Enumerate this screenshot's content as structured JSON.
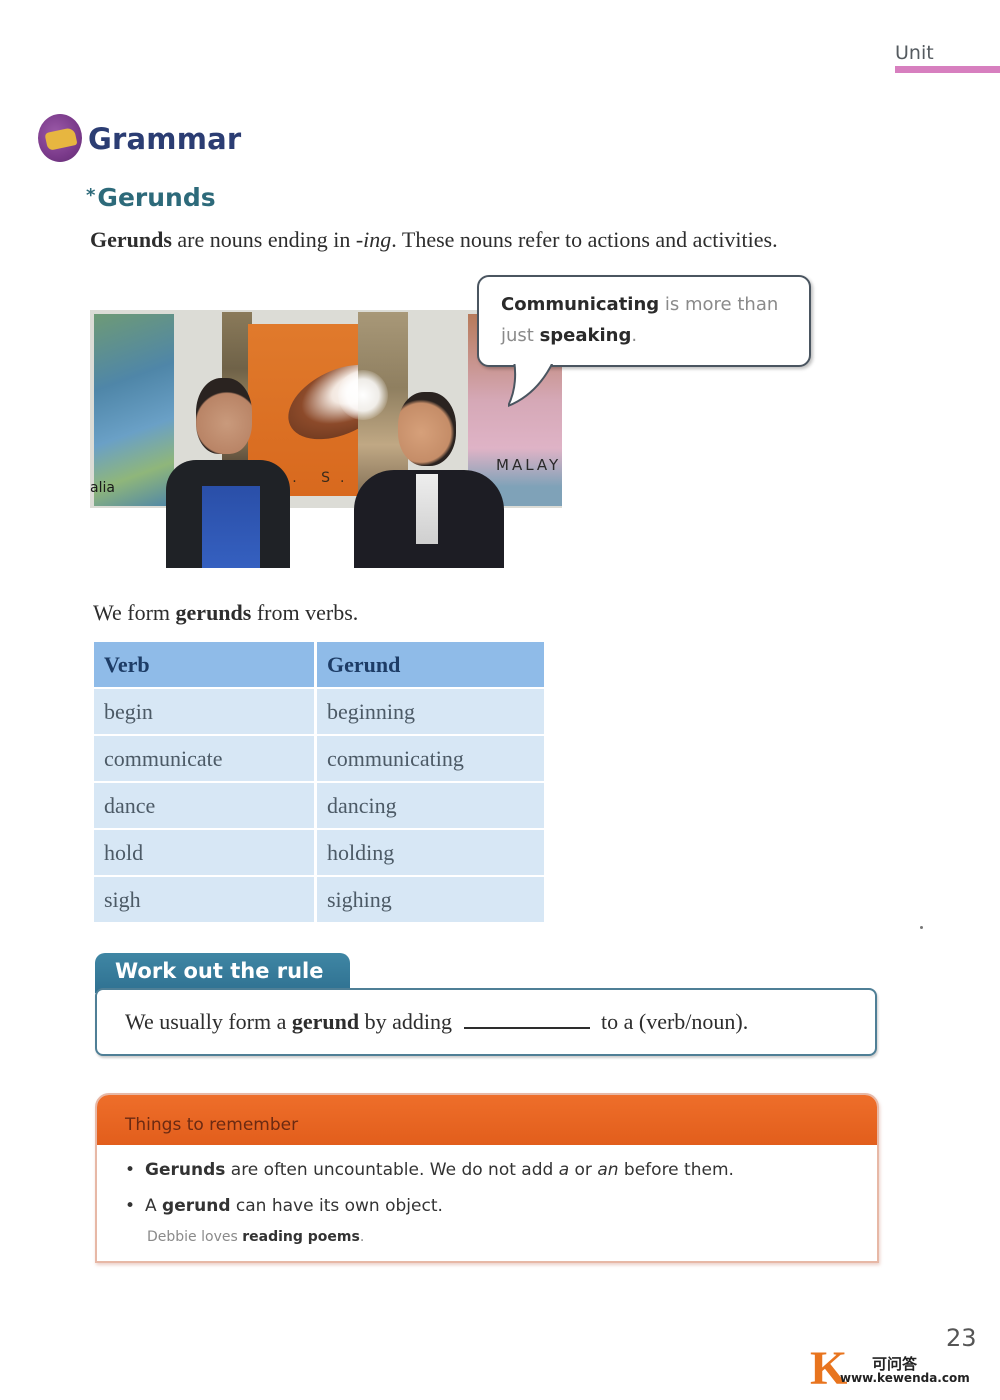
{
  "header": {
    "unit_label": "Unit",
    "unit_bar_color": "#d77fbf"
  },
  "section": {
    "title": "Grammar",
    "icon": "grammar-badge-icon",
    "subtitle_marker": "*",
    "subtitle": "Gerunds"
  },
  "intro": {
    "bold": "Gerunds",
    "text_1": " are nouns ending in ",
    "italic": "-ing",
    "text_2": ". These nouns refer to actions and activities."
  },
  "photo": {
    "alt": "A teenage boy and a man in a suit talking in front of wall posters",
    "map_label": "alia",
    "poster_label": "U. S. A.",
    "poster_right_label": "MALAY"
  },
  "speech_bubble": {
    "bold_1": "Communicating",
    "text_1": " is more than just ",
    "bold_2": "speaking",
    "text_2": "."
  },
  "form_sentence": {
    "text_1": "We form ",
    "bold": "gerunds",
    "text_2": " from verbs."
  },
  "table": {
    "headers": [
      "Verb",
      "Gerund"
    ],
    "rows": [
      [
        "begin",
        "beginning"
      ],
      [
        "communicate",
        "communicating"
      ],
      [
        "dance",
        "dancing"
      ],
      [
        "hold",
        "holding"
      ],
      [
        "sigh",
        "sighing"
      ]
    ],
    "header_color": "#8fbbe8",
    "row_color": "#d7e7f5"
  },
  "rule": {
    "tab_label": "Work out the rule",
    "text_1": "We usually form a ",
    "bold": "gerund",
    "text_2": " by adding",
    "text_3": "to a (verb/noun).",
    "accent_color": "#2f7191"
  },
  "remember": {
    "title": "Things to remember",
    "accent_color": "#e25e1c",
    "items": [
      {
        "bold": "Gerunds",
        "text_1": " are often uncountable. We do not add ",
        "italic_1": "a",
        "text_2": " or ",
        "italic_2": "an",
        "text_3": " before them."
      },
      {
        "text_0": "A ",
        "bold": "gerund",
        "text_1": " can have its own object."
      }
    ],
    "example": {
      "text": "Debbie loves ",
      "bold": "reading poems",
      "end": "."
    }
  },
  "footer": {
    "page_number": "23",
    "watermark_letter": "K",
    "watermark_cn": "可问答",
    "watermark_url": "www.kewenda.com"
  }
}
